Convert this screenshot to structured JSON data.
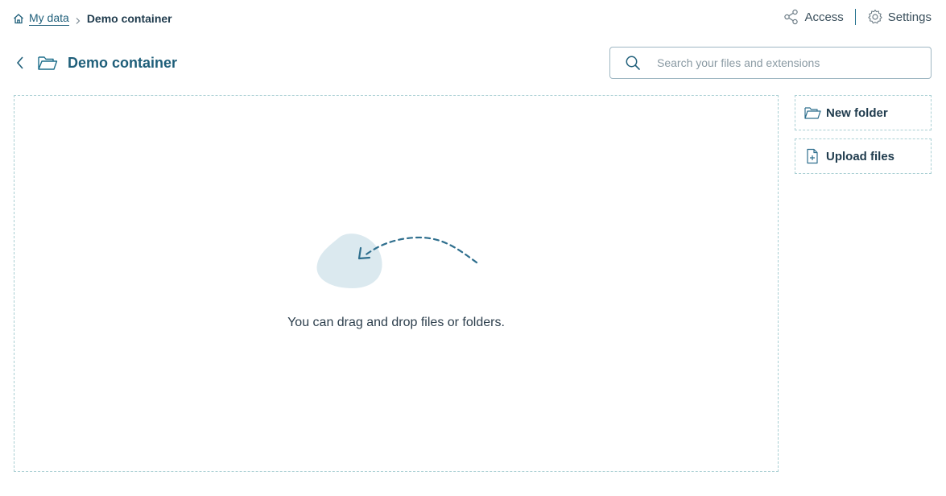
{
  "breadcrumb": {
    "home_label": "My data",
    "current_label": "Demo container"
  },
  "top_actions": {
    "access_label": "Access",
    "settings_label": "Settings"
  },
  "header": {
    "title": "Demo container"
  },
  "search": {
    "placeholder": "Search your files and extensions",
    "value": ""
  },
  "dropzone": {
    "hint": "You can drag and drop files or folders."
  },
  "actions": {
    "new_folder_label": "New folder",
    "upload_files_label": "Upload files"
  },
  "colors": {
    "accent": "#1f5f7a",
    "dashed_border": "#a9cfd3",
    "illustration_blob": "#dbe9ef"
  }
}
